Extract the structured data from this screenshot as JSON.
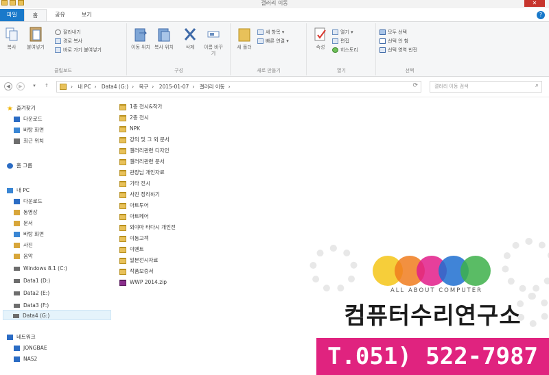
{
  "window": {
    "title": "갤러리 이동",
    "close_label": "✕"
  },
  "tabs": [
    {
      "label": "파일"
    },
    {
      "label": "홈"
    },
    {
      "label": "공유"
    },
    {
      "label": "보기"
    }
  ],
  "ribbon": {
    "clipboard": {
      "label": "클립보드",
      "copy": "복사",
      "paste": "붙여넣기",
      "cut": "잘라내기",
      "copy_path": "경로 복사",
      "paste_shortcut": "바로 가기 붙여넣기"
    },
    "organize": {
      "label": "구성",
      "move_to": "이동 위치",
      "copy_to": "복사 위치",
      "delete": "삭제",
      "rename": "이름 바꾸기"
    },
    "new": {
      "label": "새로 만들기",
      "new_folder": "새 폴더",
      "new_item": "새 항목",
      "easy_access": "빠른 연결"
    },
    "open": {
      "label": "열기",
      "properties": "속성",
      "open": "열기",
      "edit": "편집",
      "history": "히스토리"
    },
    "select": {
      "label": "선택",
      "select_all": "모두 선택",
      "select_none": "선택 안 함",
      "invert": "선택 영역 반전"
    }
  },
  "address": {
    "crumbs": [
      "내 PC",
      "Data4 (G:)",
      "복구",
      "2015-01-07",
      "갤러리 이동"
    ],
    "refresh_icon": "refresh-icon",
    "search_placeholder": "갤러리 이동 검색"
  },
  "nav": {
    "items": [
      {
        "label": "즐겨찾기",
        "icon": "star-icon",
        "color": "#f0b400"
      },
      {
        "label": "다운로드",
        "icon": "download-icon",
        "color": "#2b6cc4"
      },
      {
        "label": "바탕 화면",
        "icon": "desktop-icon",
        "color": "#3a86d4"
      },
      {
        "label": "최근 위치",
        "icon": "recent-icon",
        "color": "#6d6d6d"
      },
      {
        "label": "홈 그룹",
        "icon": "homegroup-icon",
        "color": "#2b6cc4"
      },
      {
        "label": "내 PC",
        "icon": "pc-icon",
        "color": "#3a86d4"
      },
      {
        "label": "다운로드",
        "icon": "download-icon",
        "color": "#2b6cc4"
      },
      {
        "label": "동영상",
        "icon": "video-icon",
        "color": "#d8a63a"
      },
      {
        "label": "문서",
        "icon": "document-icon",
        "color": "#d8a63a"
      },
      {
        "label": "바탕 화면",
        "icon": "desktop-icon",
        "color": "#3a86d4"
      },
      {
        "label": "사진",
        "icon": "picture-icon",
        "color": "#d8a63a"
      },
      {
        "label": "음악",
        "icon": "music-icon",
        "color": "#d8a63a"
      },
      {
        "label": "Windows 8.1 (C:)",
        "icon": "drive-icon",
        "color": "#6d6d6d"
      },
      {
        "label": "Data1 (D:)",
        "icon": "drive-icon",
        "color": "#6d6d6d"
      },
      {
        "label": "Data2 (E:)",
        "icon": "drive-icon",
        "color": "#6d6d6d"
      },
      {
        "label": "Data3 (F:)",
        "icon": "drive-icon",
        "color": "#6d6d6d"
      },
      {
        "label": "Data4 (G:)",
        "icon": "drive-icon",
        "color": "#6d6d6d",
        "selected": true
      },
      {
        "label": "네트워크",
        "icon": "network-icon",
        "color": "#2b6cc4"
      },
      {
        "label": "JONGBAE",
        "icon": "computer-icon",
        "color": "#2b6cc4"
      },
      {
        "label": "NAS2",
        "icon": "computer-icon",
        "color": "#2b6cc4"
      }
    ]
  },
  "files": [
    "1층 전시&작가",
    "2층 전시",
    "NPK",
    "강의 및 그 외 문서",
    "갤러리관련 디자인",
    "갤러리관련 문서",
    "관장님 개인자료",
    "기타 전시",
    "사진 정리하기",
    "아트투어",
    "아트페어",
    "외야마 타다시 개인전",
    "이동고객",
    "이벤트",
    "일본전시자료",
    "작품보증서",
    "WWP 2014.zip"
  ],
  "ad": {
    "tagline": "ALL ABOUT COMPUTER",
    "name": "컴퓨터수리연구소",
    "phone": "T.051) 522-7987",
    "circle_colors": [
      "#f5c518",
      "#f07c1e",
      "#e21d8a",
      "#1e6fd0",
      "#3db04a"
    ]
  }
}
